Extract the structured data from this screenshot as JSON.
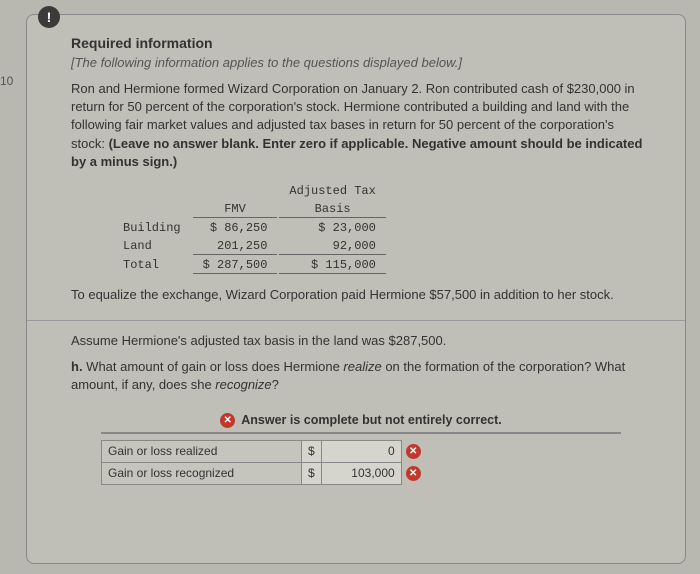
{
  "page_number": "10",
  "alert_icon": "!",
  "required_info_title": "Required information",
  "subtitle": "[The following information applies to the questions displayed below.]",
  "body_a": "Ron and Hermione formed Wizard Corporation on January 2. Ron contributed cash of $230,000 in return for 50 percent of the corporation's stock. Hermione contributed a building and land with the following fair market values and adjusted tax bases in return for 50 percent of the corporation's stock: ",
  "body_bold": "(Leave no answer blank. Enter zero if applicable. Negative amount should be indicated by a minus sign.)",
  "table": {
    "col1": "FMV",
    "col2a": "Adjusted Tax",
    "col2b": "Basis",
    "rows": [
      {
        "label": "Building",
        "fmv": "$ 86,250",
        "basis": "$ 23,000"
      },
      {
        "label": "Land",
        "fmv": "201,250",
        "basis": "92,000"
      },
      {
        "label": "Total",
        "fmv": "$ 287,500",
        "basis": "$ 115,000"
      }
    ]
  },
  "post_text": "To equalize the exchange, Wizard Corporation paid Hermione $57,500 in addition to her stock.",
  "assume_text": "Assume Hermione's adjusted tax basis in the land was $287,500.",
  "q_prefix": "h.",
  "q_a": " What amount of gain or loss does Hermione ",
  "q_ital": "realize",
  "q_b": " on the formation of the corporation? What amount, if any, does she ",
  "q_ital2": "recognize",
  "q_c": "?",
  "answer_bar_text": "Answer is complete but not entirely correct.",
  "answers": {
    "row1_label": "Gain or loss realized",
    "row1_dollar": "$",
    "row1_val": "0",
    "row2_label": "Gain or loss recognized",
    "row2_dollar": "$",
    "row2_val": "103,000"
  },
  "x_glyph": "✕"
}
